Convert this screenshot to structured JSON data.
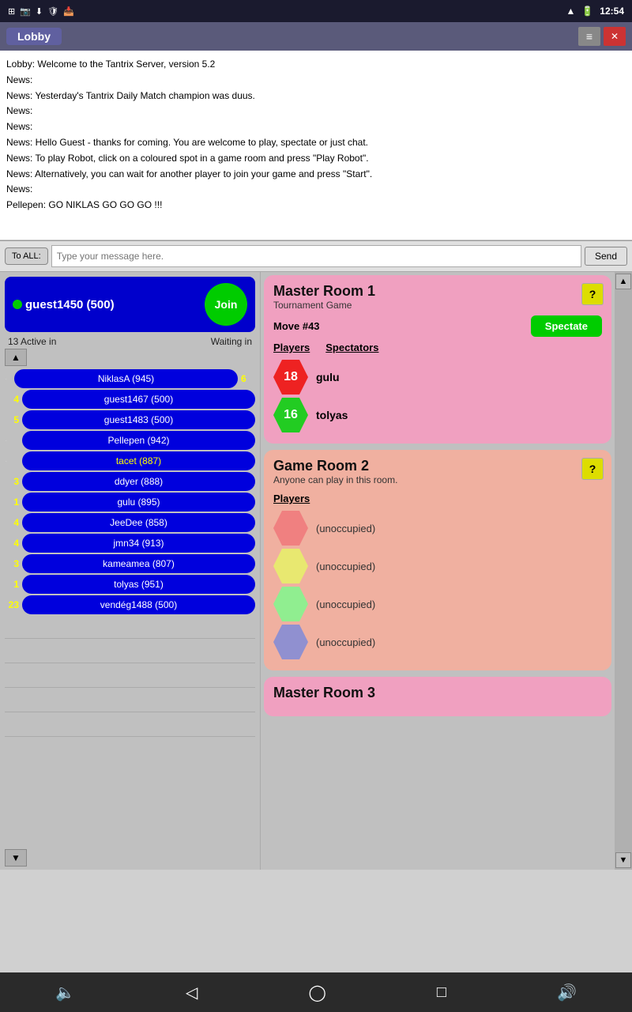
{
  "titlebar": {
    "time": "12:54",
    "icons": [
      "wifi",
      "battery"
    ]
  },
  "window": {
    "title": "Lobby",
    "menu_icon": "≡",
    "close_icon": "✕"
  },
  "chat": {
    "messages": [
      "Lobby: Welcome to the Tantrix Server, version 5.2",
      "News:",
      "News: Yesterday's Tantrix Daily Match champion was duus.",
      "News:",
      "News:",
      "News: Hello Guest - thanks for coming. You are welcome to play, spectate or just chat.",
      "News: To play Robot, click on a coloured spot in a game room and press \"Play Robot\".",
      "News: Alternatively, you can wait for another player to join your game and press \"Start\".",
      "News:",
      "Pellepen: GO NIKLAS GO GO GO !!!"
    ],
    "input_placeholder": "Type your message here.",
    "to_all_label": "To ALL:",
    "send_label": "Send"
  },
  "left_panel": {
    "guest_name": "guest1450  (500)",
    "join_label": "Join",
    "active_label": "13  Active in",
    "waiting_label": "Waiting in",
    "players": [
      {
        "rank": "",
        "name": "NiklasA  (945)",
        "extra": "6",
        "yellow": false
      },
      {
        "rank": "4",
        "name": "guest1467  (500)",
        "extra": "",
        "yellow": false
      },
      {
        "rank": "5",
        "name": "guest1483  (500)",
        "extra": "",
        "yellow": false
      },
      {
        "rank": "",
        "name": "Pellepen  (942)",
        "extra": "",
        "yellow": false
      },
      {
        "rank": "",
        "name": "tacet  (887)",
        "extra": "",
        "yellow": true
      },
      {
        "rank": "3",
        "name": "ddyer  (888)",
        "extra": "",
        "yellow": false
      },
      {
        "rank": "1",
        "name": "gulu  (895)",
        "extra": "",
        "yellow": false
      },
      {
        "rank": "4",
        "name": "JeeDee  (858)",
        "extra": "",
        "yellow": false
      },
      {
        "rank": "4",
        "name": "jmn34  (913)",
        "extra": "",
        "yellow": false
      },
      {
        "rank": "3",
        "name": "kameamea  (807)",
        "extra": "",
        "yellow": false
      },
      {
        "rank": "1",
        "name": "tolyas  (951)",
        "extra": "",
        "yellow": false
      },
      {
        "rank": "23",
        "name": "vendég1488  (500)",
        "extra": "",
        "yellow": false
      }
    ]
  },
  "rooms": [
    {
      "id": "room1",
      "title": "Master Room 1",
      "subtitle": "Tournament Game",
      "type": "pink",
      "move": "Move #43",
      "has_spectate": true,
      "spectate_label": "Spectate",
      "players_label": "Players",
      "spectators_label": "Spectators",
      "players": [
        {
          "color": "red",
          "number": "18",
          "name": "gulu"
        },
        {
          "color": "green-hex",
          "number": "16",
          "name": "tolyas"
        }
      ]
    },
    {
      "id": "room2",
      "title": "Game Room 2",
      "subtitle": "Anyone can play in this room.",
      "type": "salmon",
      "has_spectate": false,
      "players_label": "Players",
      "unoccupied_slots": [
        {
          "color": "light-red",
          "label": "(unoccupied)"
        },
        {
          "color": "light-yellow",
          "label": "(unoccupied)"
        },
        {
          "color": "light-green",
          "label": "(unoccupied)"
        },
        {
          "color": "light-blue",
          "label": "(unoccupied)"
        }
      ]
    },
    {
      "id": "room3",
      "title": "Master Room 3",
      "subtitle": "",
      "type": "pink"
    }
  ],
  "nav": {
    "icons": [
      "volume-down",
      "back",
      "home",
      "square",
      "volume-up"
    ]
  }
}
